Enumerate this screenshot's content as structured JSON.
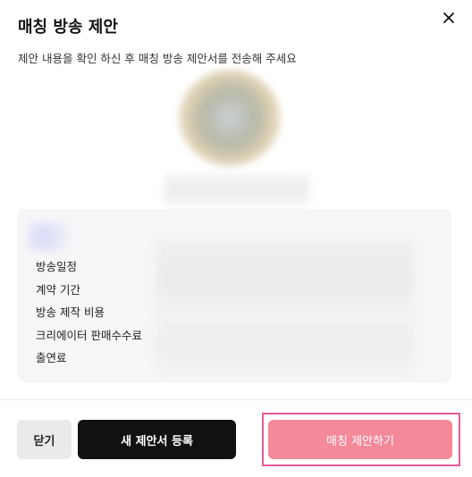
{
  "modal": {
    "title": "매칭 방송 제안",
    "subtitle": "제안 내용을 확인 하신 후 매칭 방송 제안서를 전송해 주세요"
  },
  "info": {
    "labels": [
      "방송일정",
      "계약 기간",
      "방송 제작 비용",
      "크리에이터 판매수수료",
      "출연료"
    ]
  },
  "footer": {
    "close_label": "닫기",
    "new_proposal_label": "새 제안서 등록",
    "match_proposal_label": "매칭 제안하기"
  },
  "colors": {
    "primary_dark": "#111111",
    "match_button": "#f4899a",
    "highlight_outline": "#e85a9a",
    "card_bg": "#f5f6f8"
  },
  "icons": {
    "close": "close-icon"
  }
}
